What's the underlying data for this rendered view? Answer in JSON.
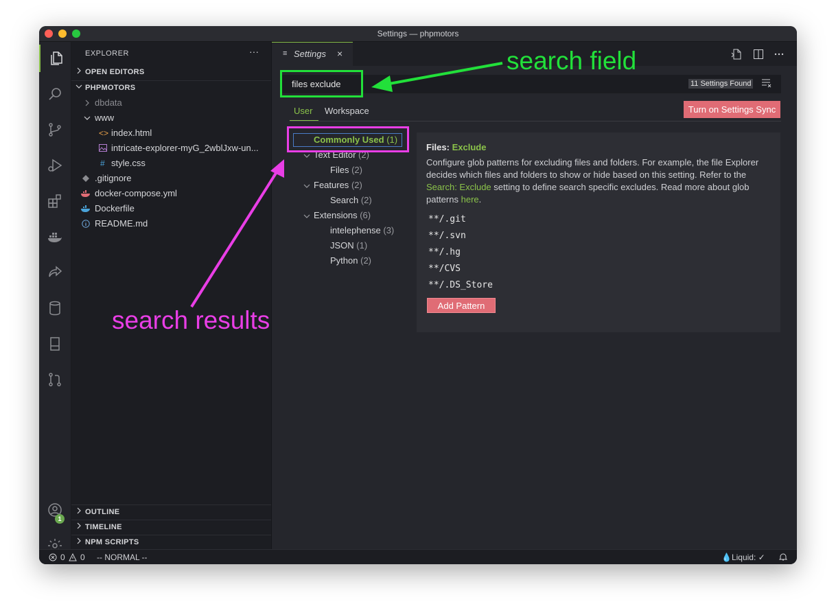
{
  "window": {
    "title": "Settings — phpmotors"
  },
  "activity_bar": {
    "items": [
      "explorer-icon",
      "search-icon",
      "source-control-icon",
      "run-debug-icon",
      "extensions-icon",
      "docker-icon",
      "live-share-icon",
      "database-icon",
      "remote-explorer-icon",
      "pull-request-icon"
    ],
    "accounts_badge": "1"
  },
  "sidebar": {
    "header": "EXPLORER",
    "more": "···",
    "open_editors": "OPEN EDITORS",
    "project": "PHPMOTORS",
    "tree": [
      {
        "label": "dbdata",
        "type": "folder",
        "expanded": false
      },
      {
        "label": "www",
        "type": "folder",
        "expanded": true
      },
      {
        "label": "index.html",
        "icon": "<>"
      },
      {
        "label": "intricate-explorer-myG_2wblJxw-un...",
        "icon": "image"
      },
      {
        "label": "style.css",
        "icon": "#"
      },
      {
        "label": ".gitignore",
        "icon": "git"
      },
      {
        "label": "docker-compose.yml",
        "icon": "docker"
      },
      {
        "label": "Dockerfile",
        "icon": "docker"
      },
      {
        "label": "README.md",
        "icon": "info"
      }
    ],
    "outline": "OUTLINE",
    "timeline": "TIMELINE",
    "npm_scripts": "NPM SCRIPTS"
  },
  "tab": {
    "icon": "≡",
    "label": "Settings",
    "close": "×"
  },
  "search": {
    "query": "files exclude",
    "found": "11 Settings Found"
  },
  "scopes": {
    "user": "User",
    "workspace": "Workspace"
  },
  "sync_button": "Turn on Settings Sync",
  "toc": [
    {
      "label": "Commonly Used",
      "count": "(1)"
    },
    {
      "label": "Text Editor",
      "count": "(2)"
    },
    {
      "label": "Files",
      "count": "(2)"
    },
    {
      "label": "Features",
      "count": "(2)"
    },
    {
      "label": "Search",
      "count": "(2)"
    },
    {
      "label": "Extensions",
      "count": "(6)"
    },
    {
      "label": "intelephense",
      "count": "(3)"
    },
    {
      "label": "JSON",
      "count": "(1)"
    },
    {
      "label": "Python",
      "count": "(2)"
    }
  ],
  "setting": {
    "category": "Files:",
    "name": "Exclude",
    "desc_1": "Configure glob patterns for excluding files and folders. For example, the file Explorer decides which files and folders to show or hide based on this setting. Refer to the",
    "link_1": "Search: Exclude",
    "desc_2": "setting to define search specific excludes. Read more about glob patterns",
    "link_2": "here",
    "desc_3": ".",
    "patterns": [
      "**/.git",
      "**/.svn",
      "**/.hg",
      "**/CVS",
      "**/.DS_Store"
    ],
    "add_button": "Add Pattern"
  },
  "status": {
    "errors": "0",
    "warnings": "0",
    "mode": "-- NORMAL --",
    "liquid": "💧Liquid: ✓"
  },
  "annotations": {
    "search_field": "search field",
    "search_results": "search results",
    "colors": {
      "green": "#22e03a",
      "pink": "#e93ee6"
    }
  },
  "colors": {
    "accent": "#8bc34a",
    "button": "#e06c75",
    "background": "#25262c"
  }
}
